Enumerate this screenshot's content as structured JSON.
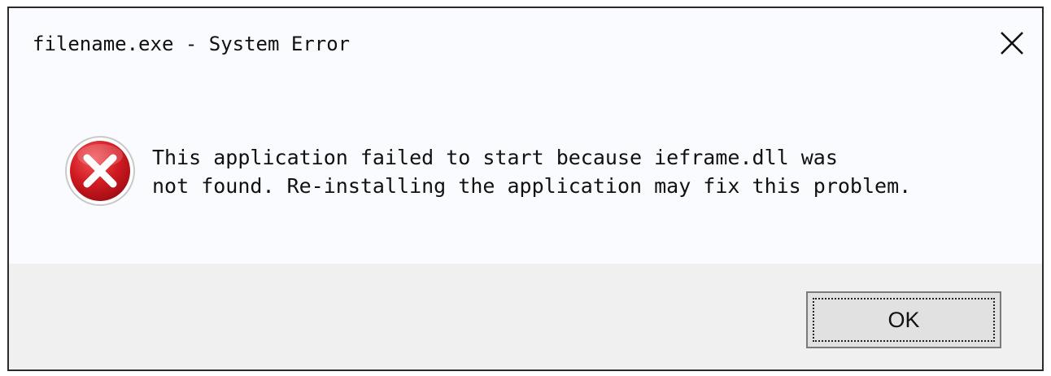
{
  "window": {
    "title": "filename.exe - System Error"
  },
  "icons": {
    "close": "close-icon",
    "error": "error-icon"
  },
  "message": {
    "line1": "This application failed to start because ieframe.dll was",
    "line2": "not found. Re-installing the application may fix this problem."
  },
  "buttons": {
    "ok_label": "OK"
  },
  "colors": {
    "error_red": "#c8141a",
    "dialog_bg": "#f9fbff",
    "footer_bg": "#f0f0f0"
  }
}
